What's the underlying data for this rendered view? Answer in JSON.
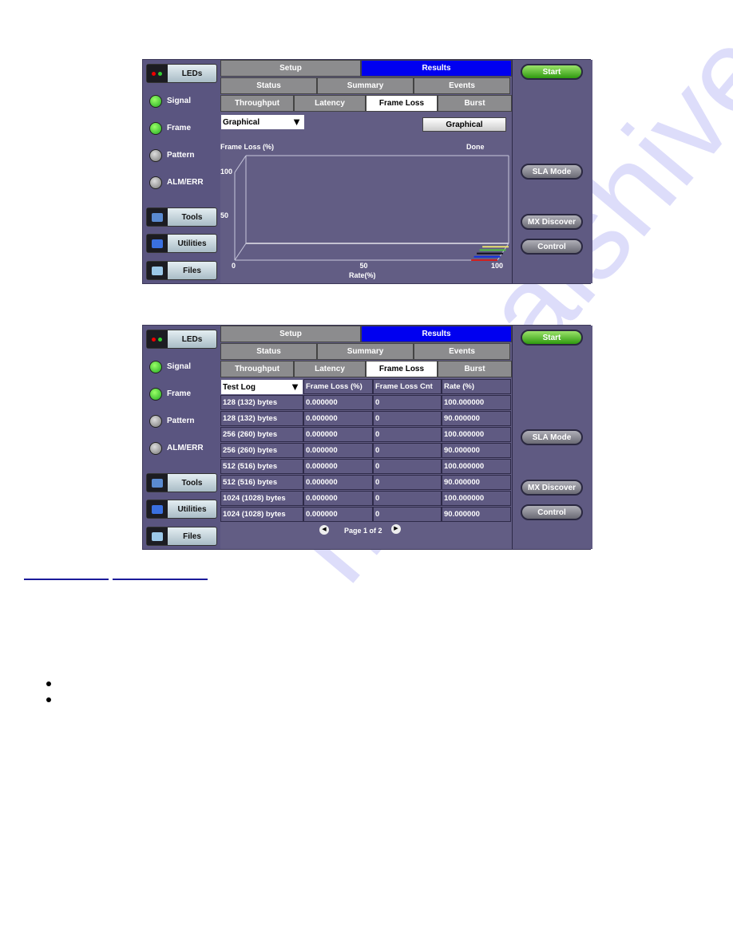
{
  "watermark": "manualshive.com",
  "screens": [
    {
      "sidebar": {
        "leds_label": "LEDs",
        "leds": [
          {
            "label": "Signal",
            "state": "green"
          },
          {
            "label": "Frame",
            "state": "green"
          },
          {
            "label": "Pattern",
            "state": "off"
          },
          {
            "label": "ALM/ERR",
            "state": "off"
          }
        ],
        "tools": "Tools",
        "utilities": "Utilities",
        "files": "Files"
      },
      "tabs_top": [
        "Setup",
        "Results"
      ],
      "tabs_mid": [
        "Status",
        "Summary",
        "Events"
      ],
      "tabs_bottom": [
        "Throughput",
        "Latency",
        "Frame Loss",
        "Burst"
      ],
      "active_tab": "Frame Loss",
      "view_select": "Graphical",
      "view_button": "Graphical",
      "right": {
        "start": "Start",
        "sla": "SLA Mode",
        "mx": "MX Discover",
        "control": "Control"
      }
    },
    {
      "sidebar": {
        "leds_label": "LEDs",
        "leds": [
          {
            "label": "Signal",
            "state": "green"
          },
          {
            "label": "Frame",
            "state": "green"
          },
          {
            "label": "Pattern",
            "state": "off"
          },
          {
            "label": "ALM/ERR",
            "state": "off"
          }
        ],
        "tools": "Tools",
        "utilities": "Utilities",
        "files": "Files"
      },
      "tabs_top": [
        "Setup",
        "Results"
      ],
      "tabs_mid": [
        "Status",
        "Summary",
        "Events"
      ],
      "tabs_bottom": [
        "Throughput",
        "Latency",
        "Frame Loss",
        "Burst"
      ],
      "active_tab": "Frame Loss",
      "table": {
        "select": "Test Log",
        "headers": [
          "Frame Loss (%)",
          "Frame Loss Cnt",
          "Rate (%)"
        ],
        "rows": [
          [
            "128 (132) bytes",
            "0.000000",
            "0",
            "100.000000"
          ],
          [
            "128 (132) bytes",
            "0.000000",
            "0",
            "90.000000"
          ],
          [
            "256 (260) bytes",
            "0.000000",
            "0",
            "100.000000"
          ],
          [
            "256 (260) bytes",
            "0.000000",
            "0",
            "90.000000"
          ],
          [
            "512 (516) bytes",
            "0.000000",
            "0",
            "100.000000"
          ],
          [
            "512 (516) bytes",
            "0.000000",
            "0",
            "90.000000"
          ],
          [
            "1024 (1028) bytes",
            "0.000000",
            "0",
            "100.000000"
          ],
          [
            "1024 (1028) bytes",
            "0.000000",
            "0",
            "90.000000"
          ]
        ]
      },
      "pager": "Page 1 of 2",
      "right": {
        "start": "Start",
        "sla": "SLA Mode",
        "mx": "MX Discover",
        "control": "Control"
      }
    }
  ],
  "colors": {
    "results_tab": "#0000f0",
    "start_button": "#3fa51a",
    "panel_bg": "#5f5b80"
  },
  "chart_data": {
    "type": "line",
    "ylabel": "Frame Loss (%)",
    "xlabel": "Rate(%)",
    "status": "Done",
    "xlim": [
      0,
      100
    ],
    "ylim": [
      0,
      100
    ],
    "xticks": [
      "0",
      "50",
      "100"
    ],
    "yticks": [
      "50",
      "100"
    ],
    "grid": false,
    "series": [
      {
        "color": "#e8e070",
        "x": [
          90,
          100
        ],
        "y": [
          0,
          0
        ]
      },
      {
        "color": "#50c040",
        "x": [
          90,
          100
        ],
        "y": [
          0,
          0
        ]
      },
      {
        "color": "#101018",
        "x": [
          90,
          100
        ],
        "y": [
          0,
          0
        ]
      },
      {
        "color": "#1030e0",
        "x": [
          90,
          100
        ],
        "y": [
          0,
          0
        ]
      },
      {
        "color": "#d02020",
        "x": [
          90,
          100
        ],
        "y": [
          0,
          0
        ]
      }
    ]
  }
}
